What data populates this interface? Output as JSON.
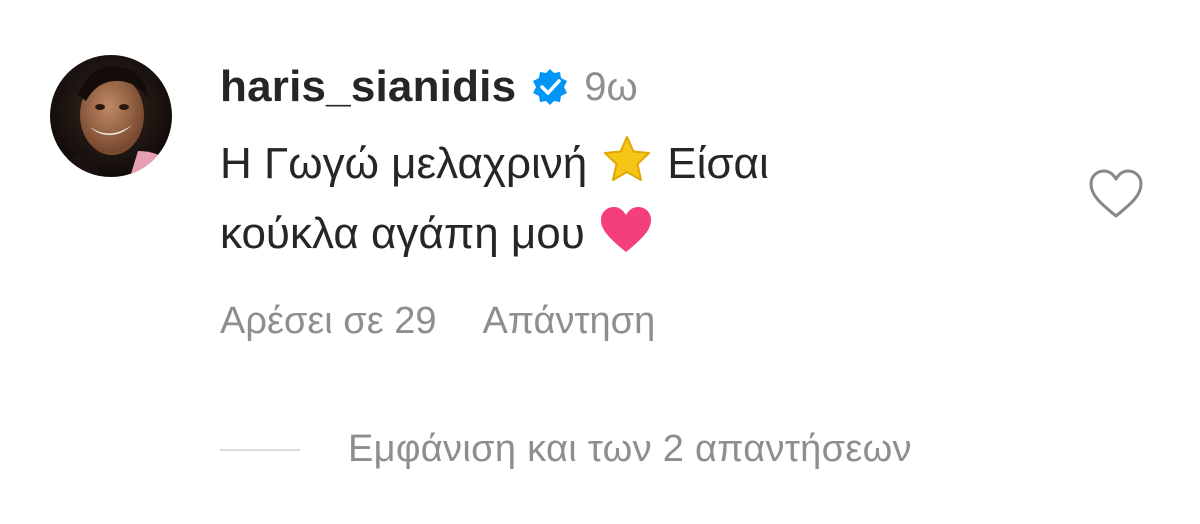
{
  "comment": {
    "username": "haris_sianidis",
    "verified": true,
    "timestamp": "9ω",
    "text_line1_part1": "Η Γωγώ μελαχρινή",
    "text_line1_part2": "Είσαι",
    "text_line2": "κούκλα αγάπη μου",
    "emoji_star": "star-emoji",
    "emoji_heart": "pink-heart-emoji",
    "likes_label": "Αρέσει σε 29",
    "reply_label": "Απάντηση",
    "view_replies_label": "Εμφάνιση και των 2 απαντήσεων"
  },
  "colors": {
    "text": "#262626",
    "secondary": "#8e8e8e",
    "verified_blue": "#0095f6",
    "star": "#f5c518",
    "heart": "#f43f7a",
    "divider": "#dbdbdb"
  },
  "icons": {
    "verified": "verified-badge-icon",
    "like": "heart-outline-icon"
  }
}
